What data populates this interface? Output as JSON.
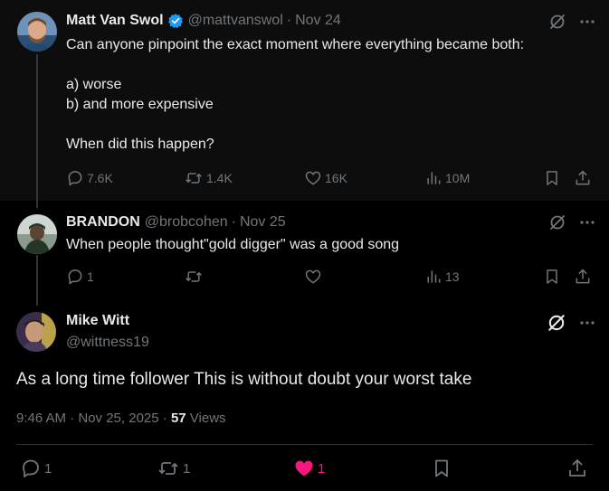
{
  "tweets": [
    {
      "name": "Matt Van Swol",
      "verified": true,
      "handle": "@mattvanswol",
      "date": "Nov 24",
      "lines": [
        "Can anyone pinpoint the exact moment where everything became both:",
        "",
        "a) worse",
        "b) and more expensive",
        "",
        "When did this happen?"
      ],
      "replies": "7.6K",
      "reposts": "1.4K",
      "likes": "16K",
      "views": "10M"
    },
    {
      "name": "BRANDON",
      "handle": "@brobcohen",
      "date": "Nov 25",
      "text": "When people thought\"gold digger\" was a good song",
      "replies": "1",
      "reposts": "",
      "likes": "",
      "views": "13"
    }
  ],
  "main_tweet": {
    "name": "Mike Witt",
    "handle": "@wittness19",
    "text": "As a long time follower This is without doubt your worst take",
    "time": "9:46 AM · Nov 25, 2025 ·",
    "views_count": "57",
    "views_label": "Views",
    "replies": "1",
    "reposts": "1",
    "likes": "1",
    "liked": true
  },
  "dot_separator": "·",
  "colors": {
    "background": "#000000",
    "text": "#e7e9ea",
    "muted": "#71767b",
    "verified": "#1d9bf0",
    "like": "#f91880"
  },
  "icons": [
    "grok-icon",
    "more-icon",
    "reply-icon",
    "repost-icon",
    "like-icon",
    "views-icon",
    "bookmark-icon",
    "share-icon",
    "verified-badge-icon"
  ]
}
